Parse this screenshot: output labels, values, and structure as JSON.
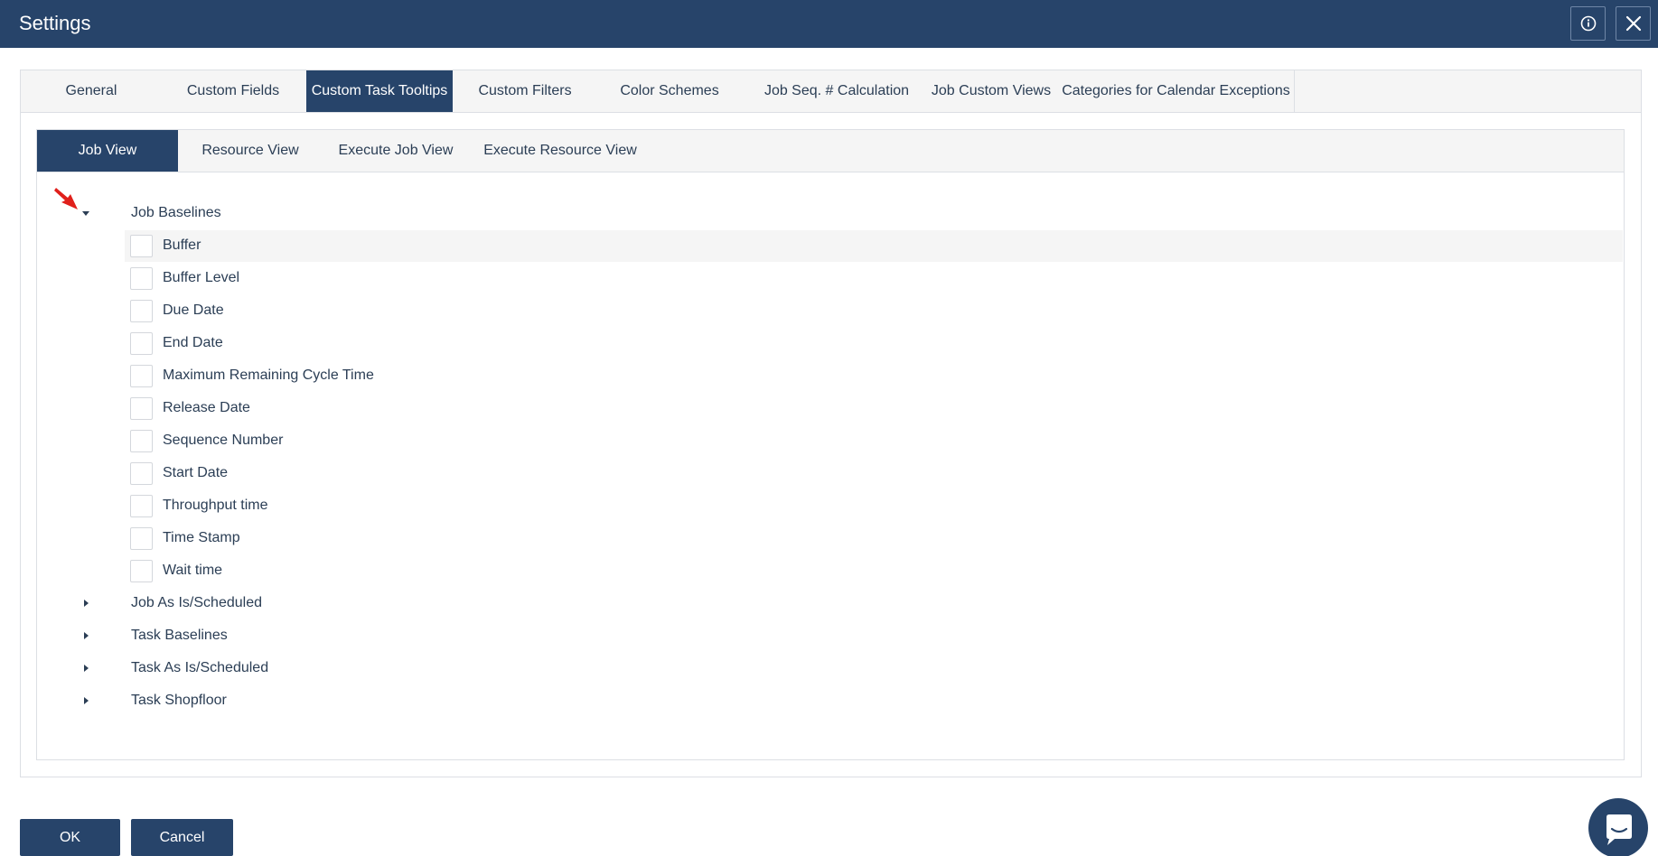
{
  "window": {
    "title": "Settings",
    "info_icon": "info-icon",
    "close_icon": "close-icon"
  },
  "tabs": [
    {
      "label": "General",
      "active": false
    },
    {
      "label": "Custom Fields",
      "active": false
    },
    {
      "label": "Custom Task Tooltips",
      "active": true
    },
    {
      "label": "Custom Filters",
      "active": false
    },
    {
      "label": "Color Schemes",
      "active": false
    },
    {
      "label": "Job Seq. # Calculation",
      "active": false
    },
    {
      "label": "Job Custom Views",
      "active": false
    },
    {
      "label": "Categories for Calendar Exceptions",
      "active": false
    }
  ],
  "subtabs": [
    {
      "label": "Job View",
      "active": true
    },
    {
      "label": "Resource View",
      "active": false
    },
    {
      "label": "Execute Job View",
      "active": false
    },
    {
      "label": "Execute Resource View",
      "active": false
    }
  ],
  "tree": {
    "expanded_group": {
      "label": "Job Baselines",
      "expanded": true,
      "items": [
        {
          "label": "Buffer",
          "checked": false,
          "highlighted": true
        },
        {
          "label": "Buffer Level",
          "checked": false
        },
        {
          "label": "Due Date",
          "checked": false
        },
        {
          "label": "End Date",
          "checked": false
        },
        {
          "label": "Maximum Remaining Cycle Time",
          "checked": false
        },
        {
          "label": "Release Date",
          "checked": false
        },
        {
          "label": "Sequence Number",
          "checked": false
        },
        {
          "label": "Start Date",
          "checked": false
        },
        {
          "label": "Throughput time",
          "checked": false
        },
        {
          "label": "Time Stamp",
          "checked": false
        },
        {
          "label": "Wait time",
          "checked": false
        }
      ]
    },
    "collapsed_groups": [
      {
        "label": "Job As Is/Scheduled",
        "expanded": false
      },
      {
        "label": "Task Baselines",
        "expanded": false
      },
      {
        "label": "Task As Is/Scheduled",
        "expanded": false
      },
      {
        "label": "Task Shopfloor",
        "expanded": false
      }
    ]
  },
  "footer": {
    "ok_label": "OK",
    "cancel_label": "Cancel",
    "chat_icon": "chat-icon"
  },
  "colors": {
    "header_bg": "#27446a",
    "text": "#2b3e55",
    "tab_bar_bg": "#f5f5f5",
    "border": "#dcdfe4",
    "pointer_arrow": "#e0201b"
  }
}
